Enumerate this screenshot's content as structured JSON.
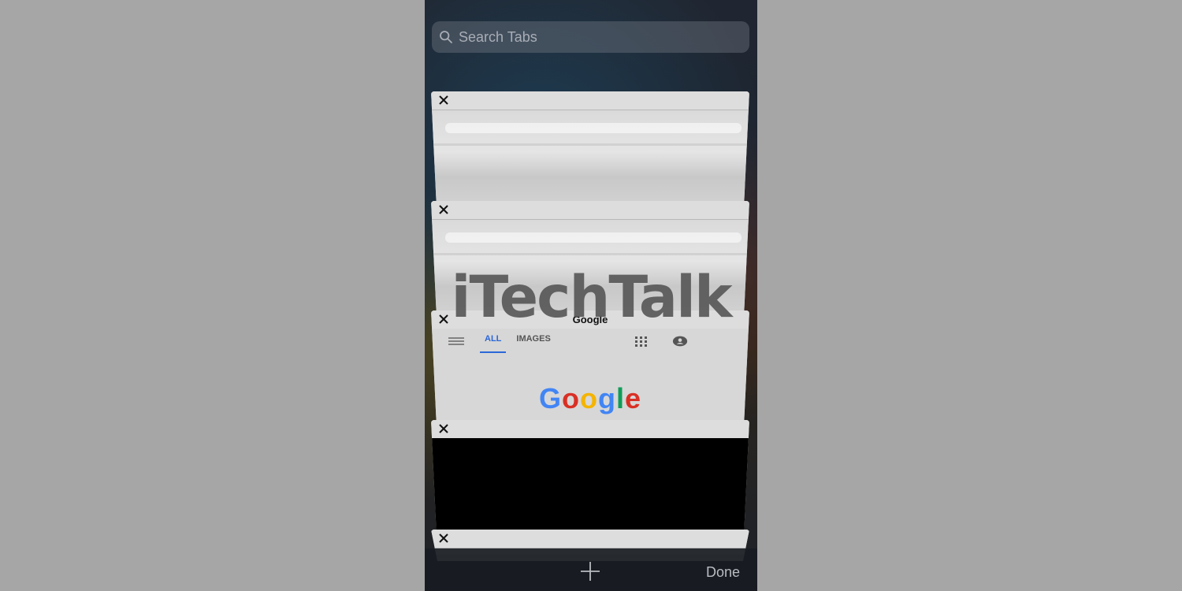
{
  "search": {
    "placeholder": "Search Tabs",
    "icon": "search-icon"
  },
  "tabs": [
    {
      "title": "",
      "close_icon": "close-icon",
      "preview": "blurred-page"
    },
    {
      "title": "",
      "close_icon": "close-icon",
      "preview": "blurred-page"
    },
    {
      "title": "Google",
      "close_icon": "close-icon",
      "preview": "google-search",
      "google": {
        "nav_all": "ALL",
        "nav_images": "IMAGES",
        "logo_letters": [
          "G",
          "o",
          "o",
          "g",
          "l",
          "e"
        ]
      }
    },
    {
      "title": "",
      "close_icon": "close-icon",
      "preview": "dark-page"
    },
    {
      "title": "",
      "close_icon": "close-icon",
      "preview": "partial-page"
    }
  ],
  "overlay": {
    "watermark": "iTechTalk"
  },
  "toolbar": {
    "new_tab_icon": "plus-icon",
    "done_label": "Done"
  },
  "colors": {
    "background": "#a6a6a6",
    "accent_blue": "#2b67d8",
    "google_blue": "#4285f4",
    "google_red": "#d93025",
    "google_yellow": "#f4b400",
    "google_green": "#0f9d58"
  }
}
